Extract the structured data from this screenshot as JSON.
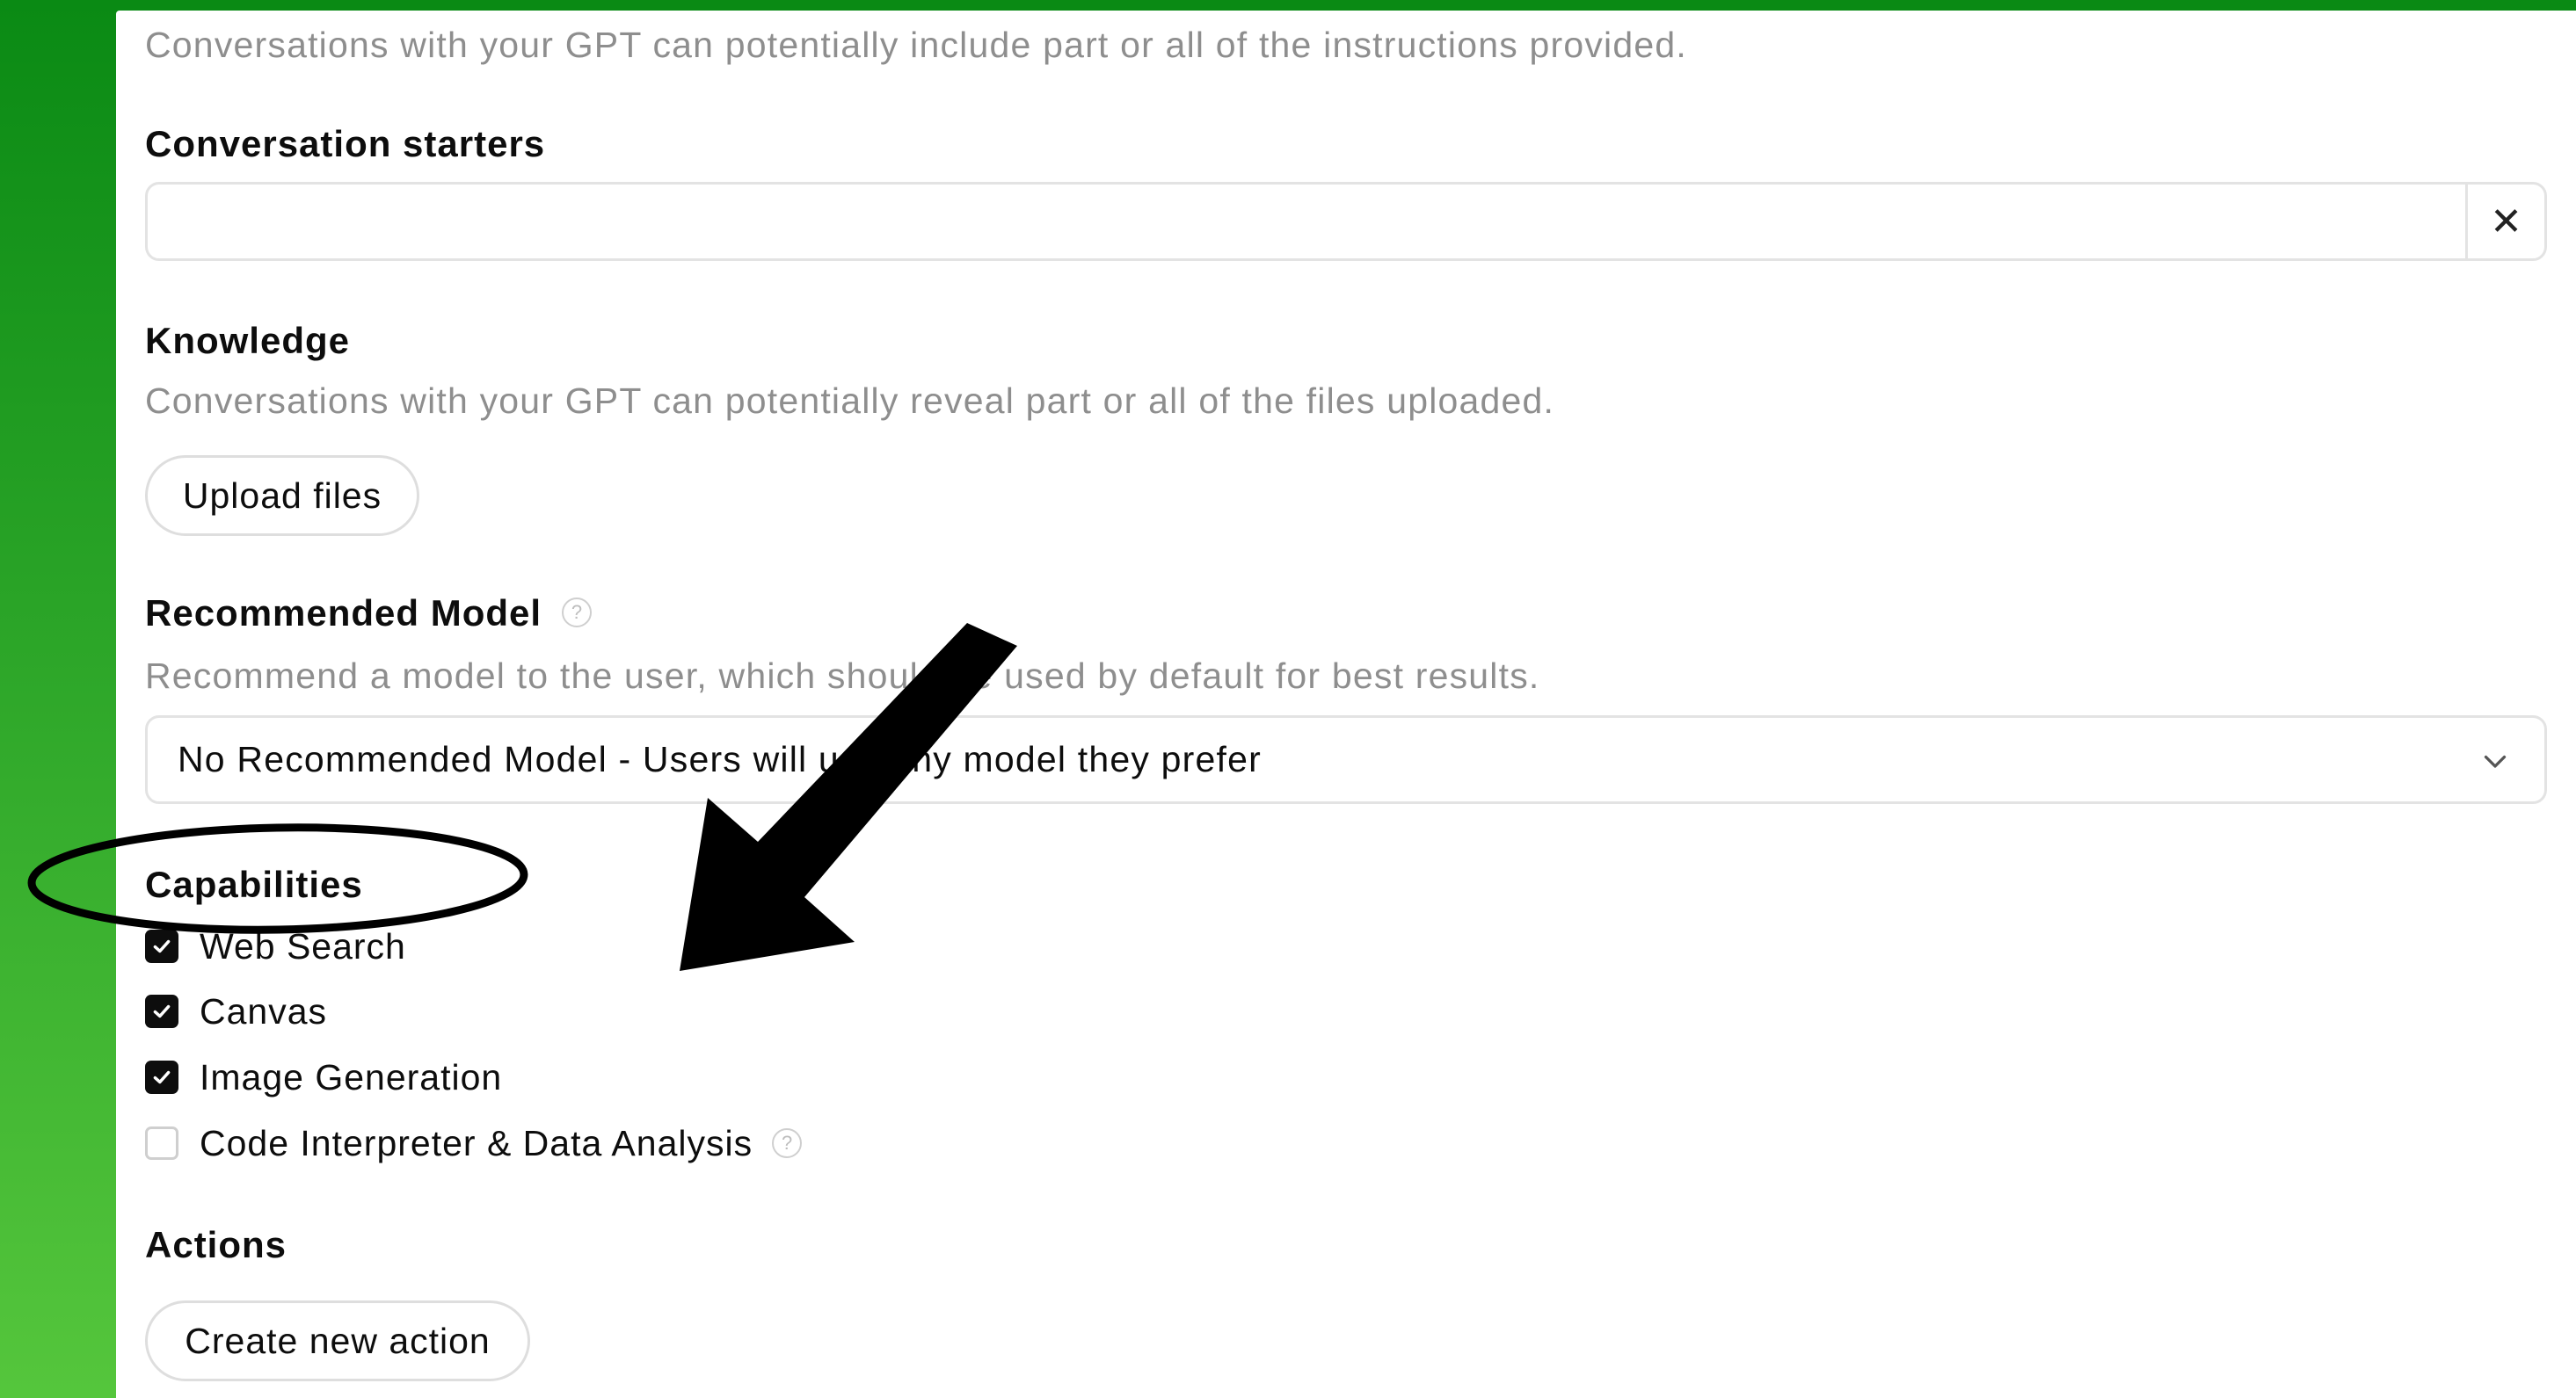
{
  "instructions_note": "Conversations with your GPT can potentially include part or all of the instructions provided.",
  "conversation_starters": {
    "heading": "Conversation starters",
    "value": "",
    "clear_symbol": "✕"
  },
  "knowledge": {
    "heading": "Knowledge",
    "description": "Conversations with your GPT can potentially reveal part or all of the files uploaded.",
    "upload_label": "Upload files"
  },
  "recommended_model": {
    "heading": "Recommended Model",
    "help_symbol": "?",
    "description": "Recommend a model to the user, which should be used by default for best results.",
    "selected": "No Recommended Model - Users will use any model they prefer"
  },
  "capabilities": {
    "heading": "Capabilities",
    "items": [
      {
        "label": "Web Search",
        "checked": true
      },
      {
        "label": "Canvas",
        "checked": true
      },
      {
        "label": "Image Generation",
        "checked": true
      },
      {
        "label": "Code Interpreter & Data Analysis",
        "checked": false
      }
    ],
    "help_symbol": "?"
  },
  "actions": {
    "heading": "Actions",
    "create_label": "Create new action"
  },
  "annotation": {
    "arrow_color": "#000000",
    "ellipse_color": "#000000"
  }
}
